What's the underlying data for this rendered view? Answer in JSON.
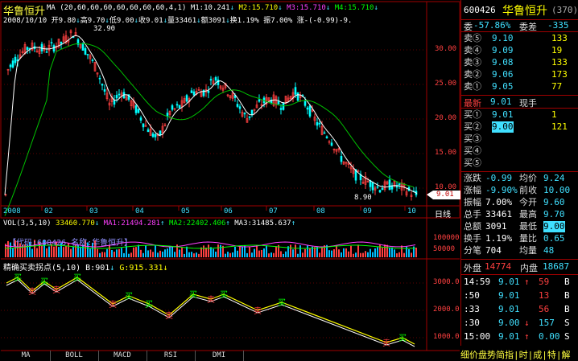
{
  "title": "华鲁恒升",
  "date_line": {
    "date": "2008/10/10",
    "open": "开9.80",
    "high": "高9.70",
    "low": "低9.00",
    "close": "收9.01",
    "vol": "量33461",
    "amount": "额3091",
    "turnover": "换1.19%",
    "amplitude": "振7.00%",
    "change": "涨-(-0.99)-9."
  },
  "ma_line": {
    "label": "MA (20,60,60,60,60,60,60,60,4,1)",
    "m1": "M1:10.241",
    "m2": "M2:15.710",
    "m3": "M3:15.710",
    "m4": "M4:15.710"
  },
  "price_annotations": {
    "high": "32.90",
    "low": "8.90",
    "last": "9.01"
  },
  "y_axis": [
    "30.00",
    "25.00",
    "20.00",
    "15.00",
    "10.00"
  ],
  "x_axis": [
    "2008",
    "02",
    "03",
    "04",
    "05",
    "06",
    "07",
    "08",
    "09",
    "10"
  ],
  "day_line_label": "日线",
  "vol_panel": {
    "label": "VOL(3,5,10)",
    "v1": "33460.770",
    "ma1": "MA1:21494.281",
    "ma2": "MA2:22402.406",
    "ma3": "MA3:31485.637",
    "overlay": "【代码:600426 名称:华鲁恒升】",
    "axis": [
      "100000",
      "50000"
    ]
  },
  "indicator_panel": {
    "label": "精确买卖拐点(5,10)",
    "b": "B:901",
    "g": "G:915.331",
    "axis": [
      "3000.0",
      "2000.0",
      "1000.0"
    ],
    "buy_mark": "买",
    "sell_mark": "卖"
  },
  "tabs": [
    "MA",
    "BOLL",
    "MACD",
    "RSI",
    "DMI"
  ],
  "quote": {
    "code": "600426",
    "name": "华鲁恒升",
    "num": "(370)",
    "wei_bi_label": "委",
    "wei_bi": "-57.86%",
    "wei_cha_label": "委差",
    "wei_cha": "-335",
    "asks": [
      {
        "label": "卖⑤",
        "price": "9.10",
        "vol": "133"
      },
      {
        "label": "卖④",
        "price": "9.09",
        "vol": "19"
      },
      {
        "label": "卖③",
        "price": "9.08",
        "vol": "133"
      },
      {
        "label": "卖②",
        "price": "9.06",
        "vol": "173"
      },
      {
        "label": "卖①",
        "price": "9.05",
        "vol": "77"
      }
    ],
    "last_label": "最新",
    "last": "9.01",
    "now_label": "现手",
    "bids": [
      {
        "label": "买①",
        "price": "9.01",
        "vol": "1"
      },
      {
        "label": "买②",
        "price": "9.00",
        "vol": "121"
      },
      {
        "label": "买③",
        "price": "",
        "vol": ""
      },
      {
        "label": "买④",
        "price": "",
        "vol": ""
      },
      {
        "label": "买⑤",
        "price": "",
        "vol": ""
      }
    ],
    "stats": [
      {
        "l1": "涨跌",
        "v1": "-0.99",
        "l2": "均价",
        "v2": "9.24"
      },
      {
        "l1": "涨幅",
        "v1": "-9.90%",
        "l2": "前收",
        "v2": "10.00"
      },
      {
        "l1": "振幅",
        "v1": "7.00%",
        "l2": "今开",
        "v2": "9.60"
      },
      {
        "l1": "总手",
        "v1": "33461",
        "l2": "最高",
        "v2": "9.70"
      },
      {
        "l1": "总额",
        "v1": "3091",
        "l2": "最低",
        "v2": "9.00"
      },
      {
        "l1": "换手",
        "v1": "1.19%",
        "l2": "量比",
        "v2": "0.65"
      },
      {
        "l1": "分笔",
        "v1": "704",
        "l2": "均量",
        "v2": "48"
      }
    ],
    "outer_label": "外盘",
    "outer": "14774",
    "inner_label": "内盘",
    "inner": "18687",
    "ticks": [
      {
        "time": "14:59",
        "price": "9.01",
        "arrow": "↑",
        "vol": "59",
        "side": "B"
      },
      {
        "time": ":50",
        "price": "9.01",
        "arrow": "",
        "vol": "13",
        "side": "B"
      },
      {
        "time": ":33",
        "price": "9.01",
        "arrow": "",
        "vol": "56",
        "side": "B"
      },
      {
        "time": ":30",
        "price": "9.00",
        "arrow": "↓",
        "vol": "157",
        "side": "S"
      },
      {
        "time": "15:00",
        "price": "9.01",
        "arrow": "↑",
        "vol": "0.00",
        "side": "S"
      }
    ],
    "bottom_tabs": "细价盘势简指|时|成|特|解"
  },
  "colors": {
    "up": "#ff4040",
    "down": "#00ffff",
    "ma_white": "#ffffff",
    "ma_green": "#00c000",
    "accent": "#40e0ff"
  }
}
